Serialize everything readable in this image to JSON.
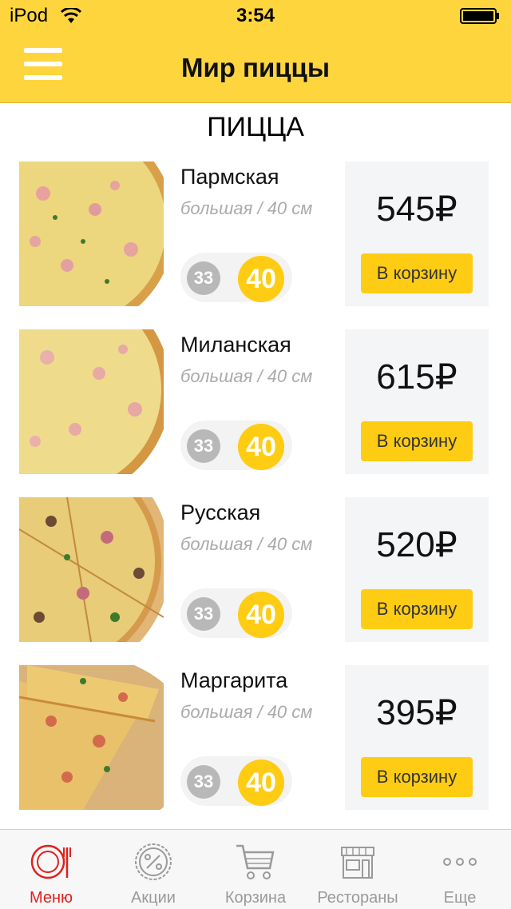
{
  "status": {
    "carrier": "iPod",
    "time": "3:54"
  },
  "nav": {
    "title": "Мир пиццы"
  },
  "section": {
    "title": "ПИЦЦА"
  },
  "items": [
    {
      "name": "Пармская",
      "size_label": "большая / 40 см",
      "size_small": "33",
      "size_large": "40",
      "price": "545₽",
      "cart_label": "В корзину"
    },
    {
      "name": "Миланская",
      "size_label": "большая / 40 см",
      "size_small": "33",
      "size_large": "40",
      "price": "615₽",
      "cart_label": "В корзину"
    },
    {
      "name": "Русская",
      "size_label": "большая / 40 см",
      "size_small": "33",
      "size_large": "40",
      "price": "520₽",
      "cart_label": "В корзину"
    },
    {
      "name": "Маргарита",
      "size_label": "большая / 40 см",
      "size_small": "33",
      "size_large": "40",
      "price": "395₽",
      "cart_label": "В корзину"
    }
  ],
  "tabs": [
    {
      "label": "Меню",
      "icon": "plate-icon"
    },
    {
      "label": "Акции",
      "icon": "discount-badge-icon"
    },
    {
      "label": "Корзина",
      "icon": "cart-icon"
    },
    {
      "label": "Рестораны",
      "icon": "store-icon"
    },
    {
      "label": "Еще",
      "icon": "more-icon"
    }
  ],
  "colors": {
    "accent": "#ffd53e",
    "button": "#ffcc14",
    "active_tab": "#e0211d"
  }
}
